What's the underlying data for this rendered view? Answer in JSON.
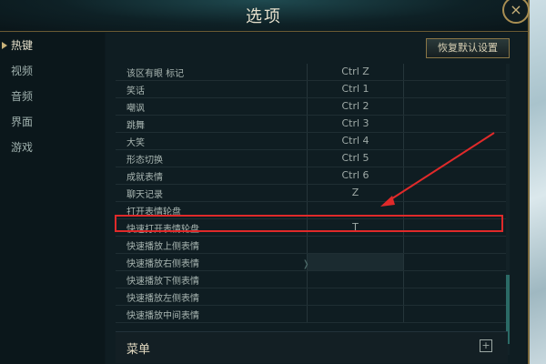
{
  "window": {
    "title": "选项",
    "close_icon": "×"
  },
  "sidebar": {
    "items": [
      {
        "label": "热键",
        "active": true
      },
      {
        "label": "视频"
      },
      {
        "label": "音频"
      },
      {
        "label": "界面"
      },
      {
        "label": "游戏"
      }
    ]
  },
  "toolbar": {
    "reset_label": "恢复默认设置"
  },
  "hotkeys": {
    "rows": [
      {
        "name": "该区有眼 标记",
        "key": "Ctrl  Z"
      },
      {
        "name": "笑话",
        "key": "Ctrl  1"
      },
      {
        "name": "嘲讽",
        "key": "Ctrl  2"
      },
      {
        "name": "跳舞",
        "key": "Ctrl  3"
      },
      {
        "name": "大笑",
        "key": "Ctrl  4"
      },
      {
        "name": "形态切换",
        "key": "Ctrl  5"
      },
      {
        "name": "成就表情",
        "key": "Ctrl  6"
      },
      {
        "name": "聊天记录",
        "key": "Z"
      },
      {
        "name": "打开表情轮盘",
        "key": ""
      },
      {
        "name": "快速打开表情轮盘",
        "key": "T"
      },
      {
        "name": "快速播放上侧表情",
        "key": ""
      },
      {
        "name": "快速播放右侧表情",
        "key": ""
      },
      {
        "name": "快速播放下侧表情",
        "key": ""
      },
      {
        "name": "快速播放左侧表情",
        "key": ""
      },
      {
        "name": "快速播放中间表情",
        "key": ""
      }
    ]
  },
  "menu_section": {
    "title": "菜单",
    "expand_icon": "+"
  },
  "colors": {
    "accent_gold": "#c9b27a",
    "highlight_red": "#e02a2a"
  }
}
